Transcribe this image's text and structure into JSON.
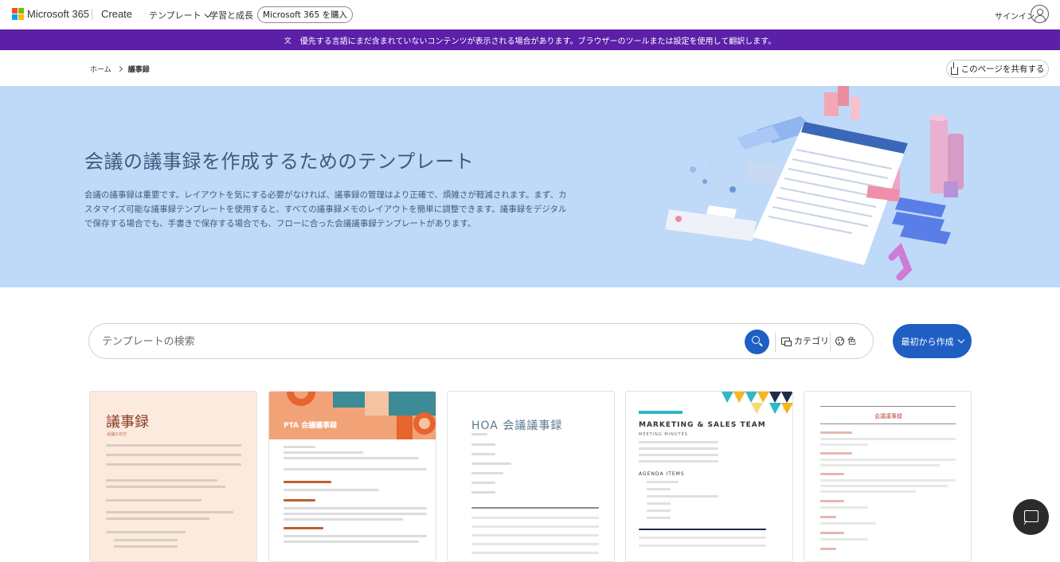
{
  "nav": {
    "brand": "Microsoft 365",
    "create": "Create",
    "templates": "テンプレート",
    "learn": "学習と成長",
    "buy": "Microsoft 365 を購入",
    "signin": "サインイン"
  },
  "banner": {
    "text": "優先する言語にまだ含まれていないコンテンツが表示される場合があります。ブラウザーのツールまたは設定を使用して翻訳します。"
  },
  "breadcrumb": {
    "home": "ホーム",
    "current": "議事録"
  },
  "share": "このページを共有する",
  "hero": {
    "title": "会議の議事録を作成するためのテンプレート",
    "description": "会議の議事録は重要です。レイアウトを気にする必要がなければ、議事録の管理はより正確で、煩雑さが軽減されます。まず、カスタマイズ可能な議事録テンプレートを使用すると、すべての議事録メモのレイアウトを簡単に調整できます。議事録をデジタルで保存する場合でも、手書きで保存する場合でも、フローに合った会議議事録テンプレートがあります。"
  },
  "search": {
    "placeholder": "テンプレートの検索",
    "category": "カテゴリ",
    "color": "色"
  },
  "create_button": "最初から作成",
  "cards": [
    {
      "title": "議事録",
      "subtitle": "会議の日付"
    },
    {
      "title": "PTA 会議議事録"
    },
    {
      "title": "HOA 会議議事録"
    },
    {
      "title": "MARKETING & SALES TEAM",
      "subtitle": "MEETING MINUTES",
      "section": "AGENDA ITEMS"
    },
    {
      "title": "会議議事録"
    }
  ],
  "colors": {
    "banner": "#5b1fa8",
    "hero_bg": "#bfd9f8",
    "accent": "#1f5fc4"
  }
}
